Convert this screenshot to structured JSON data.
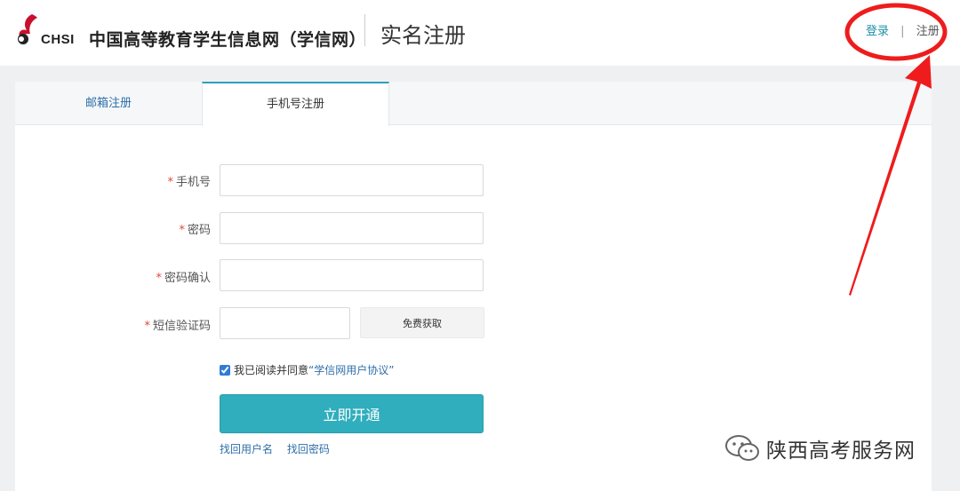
{
  "header": {
    "logo_text": "CHSI",
    "site_name": "中国高等教育学生信息网（学信网）",
    "page_title": "实名注册",
    "links": {
      "login": "登录",
      "separator": "|",
      "register": "注册"
    }
  },
  "tabs": [
    {
      "label": "邮箱注册",
      "active": false
    },
    {
      "label": "手机号注册",
      "active": true
    }
  ],
  "form": {
    "required_mark": "*",
    "phone_label": "手机号",
    "phone_value": "",
    "password_label": "密码",
    "password_value": "",
    "confirm_label": "密码确认",
    "confirm_value": "",
    "sms_label": "短信验证码",
    "sms_value": "",
    "sms_button": "免费获取",
    "agree_checked": true,
    "agree_text": "我已阅读并同意",
    "agree_link": "“学信网用户协议”",
    "submit_label": "立即开通",
    "find_username": "找回用户名",
    "find_password": "找回密码"
  },
  "colors": {
    "accent": "#30aebd",
    "link": "#2f6fa8",
    "required": "#e5473b",
    "annotation": "#ee1c1c"
  },
  "watermark": {
    "text": "陕西高考服务网"
  }
}
